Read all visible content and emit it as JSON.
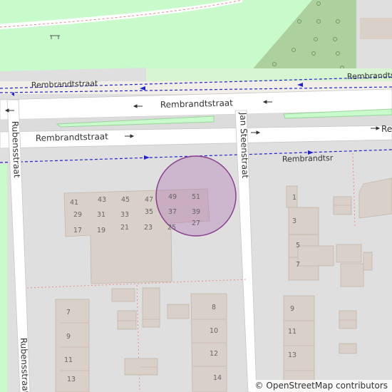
{
  "map": {
    "streets": {
      "rembrandt_top_right": "Rembrandtstraat",
      "rembrandt_upper": "Rembrandtstraat",
      "rembrandt_lower": "Rembrandtstraat",
      "rembrandt_cycle": "Rembrandtstraat",
      "rembrandt_edge": "Re",
      "jan_steen": "Jan Steenstraat",
      "rubens_top": "Rubensstraat",
      "rubens_bottom": "Rubensstraat",
      "rembrandt_far": "Rembrandtsr"
    },
    "house_numbers": {
      "n41": "41",
      "n43": "43",
      "n45": "45",
      "n47": "47",
      "n49": "49",
      "n51": "51",
      "n29": "29",
      "n31": "31",
      "n33": "33",
      "n35": "35",
      "n37": "37",
      "n39": "39",
      "n17": "17",
      "n19": "19",
      "n21": "21",
      "n23": "23",
      "n25": "25",
      "n27": "27",
      "n1": "1",
      "n3": "3",
      "n5": "5",
      "n7r": "7",
      "n7l": "7",
      "n9l": "9",
      "n11l": "11",
      "n13l": "13",
      "n8": "8",
      "n10": "10",
      "n12": "12",
      "n14": "14",
      "n9r": "9",
      "n11r": "11",
      "n13r": "13"
    },
    "marker": {
      "label": "selected-location",
      "fill": "#b07ab4",
      "stroke": "#8a3f8f"
    },
    "colors": {
      "park": "#c8facc",
      "wood": "#add19e",
      "building": "#d9d0c9",
      "road": "#ffffff",
      "background": "#e0dfdf"
    }
  },
  "attribution": {
    "symbol": "©",
    "text": "OpenStreetMap contributors"
  }
}
